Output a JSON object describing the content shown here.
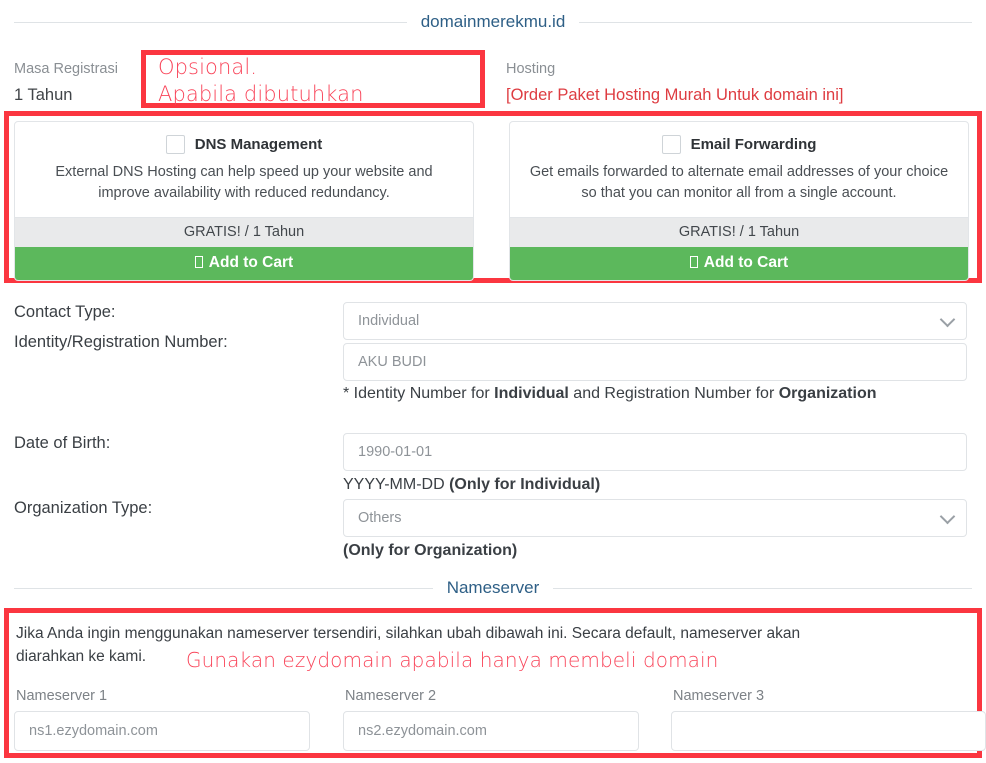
{
  "header": {
    "domain_title": "domainmerekmu.id"
  },
  "summary": {
    "registration_period_label": "Masa Registrasi",
    "registration_period_value": "1 Tahun",
    "hosting_label": "Hosting",
    "hosting_link": "[Order Paket Hosting Murah Untuk domain ini]"
  },
  "annotations": {
    "optional_line1": "Opsional.",
    "optional_line2": "Apabila dibutuhkan",
    "nameserver_note": "Gunakan ezydomain apabila hanya membeli domain",
    "box_color": "#fb3640",
    "text_color": "#f9455a"
  },
  "addons": [
    {
      "name": "DNS Management",
      "description": "External DNS Hosting can help speed up your website and improve availability with reduced redundancy.",
      "price": "GRATIS! / 1 Tahun",
      "cart_label": "Add to Cart",
      "checked": false
    },
    {
      "name": "Email Forwarding",
      "description": "Get emails forwarded to alternate email addresses of your choice so that you can monitor all from a single account.",
      "price": "GRATIS! / 1 Tahun",
      "cart_label": "Add to Cart",
      "checked": false
    }
  ],
  "form": {
    "contact_type": {
      "label": "Contact Type:",
      "value": "Individual"
    },
    "identity_number": {
      "label": "Identity/Registration Number:",
      "placeholder": "AKU BUDI",
      "help_prefix": "* Identity Number for ",
      "help_bold1": "Individual",
      "help_mid": " and Registration Number for ",
      "help_bold2": "Organization"
    },
    "date_of_birth": {
      "label": "Date of Birth:",
      "placeholder": "1990-01-01",
      "help_prefix": "YYYY-MM-DD ",
      "help_bold": "(Only for Individual)"
    },
    "organization_type": {
      "label": "Organization Type:",
      "value": "Others",
      "help_bold": "(Only for Organization)"
    }
  },
  "nameserver": {
    "section_title": "Nameserver",
    "paragraph_line1": "Jika Anda ingin menggunakan nameserver tersendiri, silahkan ubah dibawah ini. Secara default, nameserver akan",
    "paragraph_line2": "diarahkan ke kami.",
    "fields": [
      {
        "label": "Nameserver 1",
        "value": "ns1.ezydomain.com"
      },
      {
        "label": "Nameserver 2",
        "value": "ns2.ezydomain.com"
      },
      {
        "label": "Nameserver 3",
        "value": ""
      }
    ]
  },
  "icons": {
    "chevron_down": "chevron-down-icon",
    "cart": "cart-icon",
    "checkbox": "checkbox-unchecked-icon"
  }
}
